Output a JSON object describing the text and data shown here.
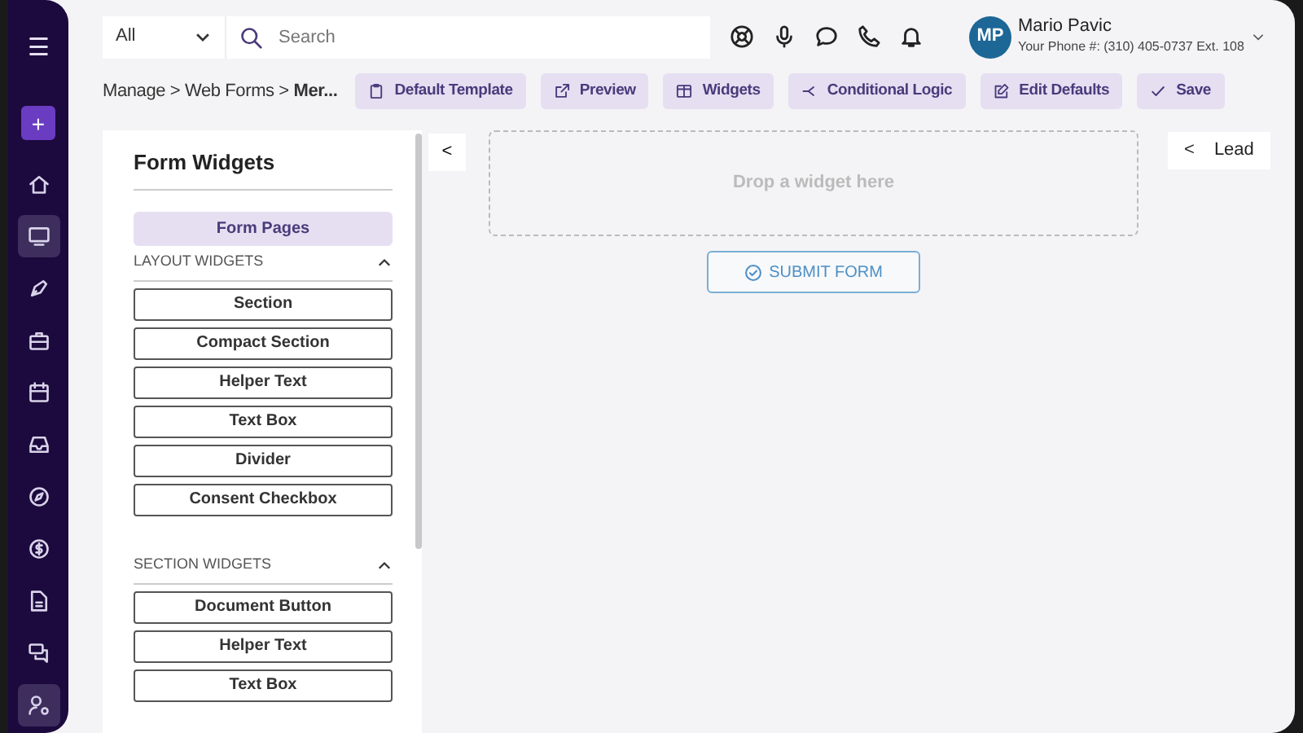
{
  "sidebar": {
    "menu_icon": "☰",
    "add_button": "+",
    "items": [
      {
        "selected": false
      },
      {
        "selected": true
      },
      {
        "selected": false
      },
      {
        "selected": false
      },
      {
        "selected": false
      },
      {
        "selected": false
      },
      {
        "selected": false
      },
      {
        "selected": false
      },
      {
        "selected": false
      },
      {
        "selected": false
      },
      {
        "selected": true
      }
    ]
  },
  "topbar": {
    "scope_select": "All",
    "search": {
      "placeholder": "Search"
    },
    "user": {
      "initials": "MP",
      "name": "Mario Pavic",
      "phone": "Your Phone #: (310) 405-0737 Ext. 108"
    }
  },
  "breadcrumb": {
    "path": "Manage > Web Forms > ",
    "current": "Mer..."
  },
  "toolbar": [
    "Default Template",
    "Preview",
    "Widgets",
    "Conditional Logic",
    "Edit Defaults",
    "Save"
  ],
  "widgets_panel": {
    "title": "Form Widgets",
    "pages_button": "Form Pages",
    "sections": [
      {
        "title": "LAYOUT WIDGETS",
        "expanded": true,
        "items": [
          "Section",
          "Compact Section",
          "Helper Text",
          "Text Box",
          "Divider",
          "Consent Checkbox"
        ]
      },
      {
        "title": "SECTION WIDGETS",
        "expanded": true,
        "items": [
          "Document Button",
          "Helper Text",
          "Text Box"
        ]
      }
    ]
  },
  "canvas": {
    "collapse_button": "<",
    "drop_zone": "Drop a widget here",
    "submit_button": "SUBMIT FORM",
    "side_tab": {
      "arrow": "<",
      "label": "Lead"
    }
  }
}
